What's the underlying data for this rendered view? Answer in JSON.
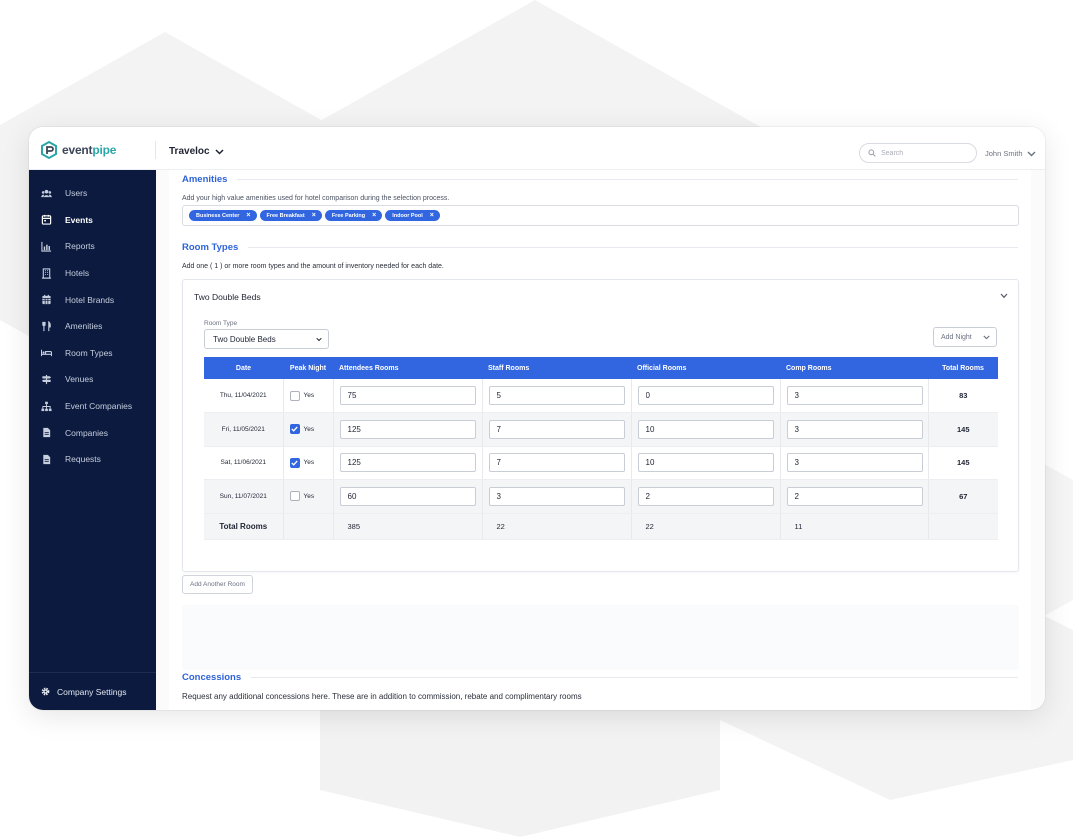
{
  "app": {
    "brand_a": "event",
    "brand_b": "pipe",
    "org": "Traveloc",
    "user": "John Smith"
  },
  "search": {
    "placeholder": "Search"
  },
  "colors": {
    "sidebar": "#0b1a3e",
    "accent": "#3265e0",
    "brand_teal": "#2ba7a9"
  },
  "sidebar": {
    "items": [
      {
        "label": "Users",
        "icon": "users-icon"
      },
      {
        "label": "Events",
        "icon": "calendar-icon",
        "active": true
      },
      {
        "label": "Reports",
        "icon": "chart-icon"
      },
      {
        "label": "Hotels",
        "icon": "building-icon"
      },
      {
        "label": "Hotel Brands",
        "icon": "calendar-grid-icon"
      },
      {
        "label": "Amenities",
        "icon": "utensils-icon"
      },
      {
        "label": "Room Types",
        "icon": "bed-icon"
      },
      {
        "label": "Venues",
        "icon": "signpost-icon"
      },
      {
        "label": "Event Companies",
        "icon": "org-chart-icon"
      },
      {
        "label": "Companies",
        "icon": "document-icon"
      },
      {
        "label": "Requests",
        "icon": "document-icon"
      }
    ],
    "footer": "Company Settings"
  },
  "amenities": {
    "title": "Amenities",
    "helper": "Add your high value amenities used for hotel comparison during the selection process.",
    "tags": [
      "Business Center",
      "Free Breakfast",
      "Free Parking",
      "Indoor Pool"
    ]
  },
  "room_types": {
    "title": "Room Types",
    "helper": "Add one ( 1 ) or more room types and the amount of inventory needed for each date.",
    "card_title": "Two Double Beds",
    "room_type_label": "Room Type",
    "room_type_value": "Two Double Beds",
    "add_night": "Add Night",
    "columns": [
      "Date",
      "Peak Night",
      "Attendees Rooms",
      "Staff Rooms",
      "Official Rooms",
      "Comp Rooms",
      "Total Rooms"
    ],
    "peak_label": "Yes",
    "rows": [
      {
        "date": "Thu, 11/04/2021",
        "peak": false,
        "attendees": "75",
        "staff": "5",
        "official": "0",
        "comp": "3",
        "total": "83"
      },
      {
        "date": "Fri, 11/05/2021",
        "peak": true,
        "attendees": "125",
        "staff": "7",
        "official": "10",
        "comp": "3",
        "total": "145"
      },
      {
        "date": "Sat, 11/06/2021",
        "peak": true,
        "attendees": "125",
        "staff": "7",
        "official": "10",
        "comp": "3",
        "total": "145"
      },
      {
        "date": "Sun, 11/07/2021",
        "peak": false,
        "attendees": "60",
        "staff": "3",
        "official": "2",
        "comp": "2",
        "total": "67"
      }
    ],
    "totals": {
      "label": "Total Rooms",
      "attendees": "385",
      "staff": "22",
      "official": "22",
      "comp": "11"
    },
    "add_room": "Add Another Room"
  },
  "concessions": {
    "title": "Concessions",
    "helper": "Request any additional concessions here. These are in addition to commission, rebate and complimentary rooms"
  }
}
